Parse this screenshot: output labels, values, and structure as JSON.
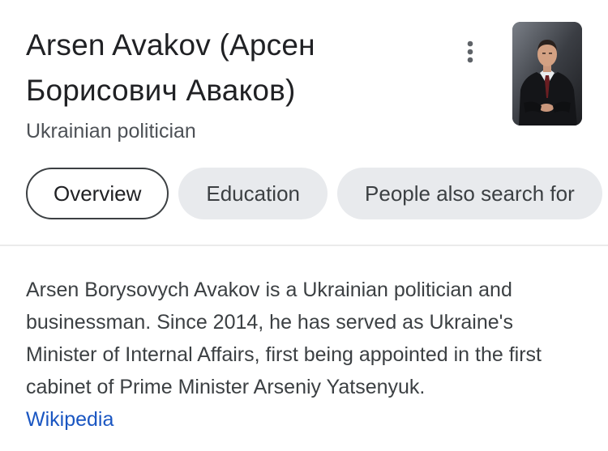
{
  "header": {
    "title": "Arsen Avakov (Арсен Борисович Аваков)",
    "subtitle": "Ukrainian politician",
    "more_icon": "more-vert-icon"
  },
  "thumbnail": {
    "alt": "Arsen Avakov"
  },
  "chips": [
    {
      "label": "Overview",
      "selected": true
    },
    {
      "label": "Education",
      "selected": false
    },
    {
      "label": "People also search for",
      "selected": false
    }
  ],
  "description": {
    "text": "Arsen Borysovych Avakov is a Ukrainian politician and businessman. Since 2014, he has served as Ukraine's Minister of Internal Affairs, first being appointed in the first cabinet of Prime Minister Arseniy Yatsenyuk.",
    "source_label": "Wikipedia"
  },
  "colors": {
    "text_primary": "#202124",
    "text_secondary": "#4d5156",
    "link": "#1a56c2",
    "chip_bg": "#e8eaed"
  }
}
